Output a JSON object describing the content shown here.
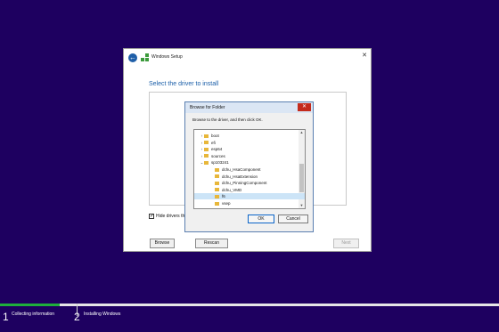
{
  "setup_window": {
    "title": "Windows Setup",
    "close_glyph": "✕",
    "back_glyph": "←",
    "heading": "Select the driver to install",
    "hide_drivers_label": "Hide drivers th",
    "hide_drivers_checked": true,
    "buttons": {
      "browse": "Browse",
      "rescan": "Rescan",
      "next": "Next"
    }
  },
  "browse_dialog": {
    "title": "Browse for Folder",
    "close_glyph": "✕",
    "instruction": "Browse to the driver, and then click OK.",
    "tree_items": [
      {
        "label": "boot",
        "chevron": "›"
      },
      {
        "label": "efi",
        "chevron": "›"
      },
      {
        "label": "esp64",
        "chevron": "›"
      },
      {
        "label": "sources",
        "chevron": "›"
      },
      {
        "label": "sp103241",
        "chevron": "⌄"
      },
      {
        "label": "dchu_HsaComponent",
        "chevron": ""
      },
      {
        "label": "dchu_HsaExtension",
        "chevron": ""
      },
      {
        "label": "dchu_PinningComponent",
        "chevron": ""
      },
      {
        "label": "dchu_VMD",
        "chevron": ""
      },
      {
        "label": "f6",
        "chevron": ""
      },
      {
        "label": "vsep",
        "chevron": ""
      }
    ],
    "selected_item": "f6",
    "buttons": {
      "ok": "OK",
      "cancel": "Cancel"
    }
  },
  "progress": {
    "fraction_complete": 0.12,
    "steps": [
      {
        "number": "1",
        "label": "Collecting information"
      },
      {
        "number": "2",
        "label": "Installing Windows"
      }
    ]
  },
  "colors": {
    "background": "#1e0060",
    "accent_blue": "#1a5ea8",
    "progress_green": "#1fae3c",
    "close_red": "#c42b1c",
    "folder_yellow": "#e8b73a"
  }
}
